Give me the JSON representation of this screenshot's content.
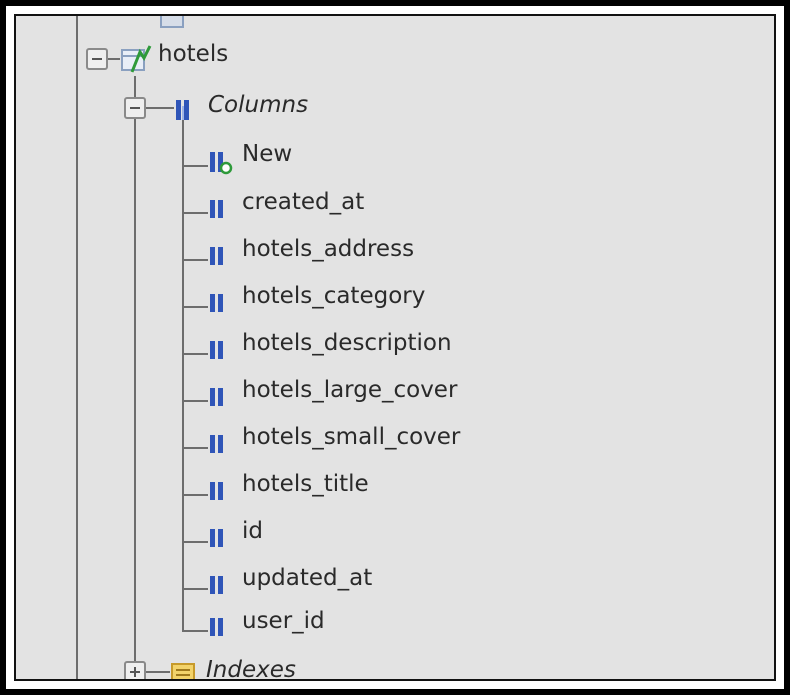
{
  "tree": {
    "table": {
      "label": "hotels",
      "icon": "table-icon",
      "expander": "minus"
    },
    "columns_group": {
      "label": "Columns",
      "icon": "columns-icon",
      "expander": "minus"
    },
    "columns": [
      {
        "label": "New",
        "icon": "new-column-icon"
      },
      {
        "label": "created_at",
        "icon": "column-icon"
      },
      {
        "label": "hotels_address",
        "icon": "column-icon"
      },
      {
        "label": "hotels_category",
        "icon": "column-icon"
      },
      {
        "label": "hotels_description",
        "icon": "column-icon"
      },
      {
        "label": "hotels_large_cover",
        "icon": "column-icon"
      },
      {
        "label": "hotels_small_cover",
        "icon": "column-icon"
      },
      {
        "label": "hotels_title",
        "icon": "column-icon"
      },
      {
        "label": "id",
        "icon": "column-icon"
      },
      {
        "label": "updated_at",
        "icon": "column-icon"
      },
      {
        "label": "user_id",
        "icon": "column-icon"
      }
    ],
    "indexes_group": {
      "label": "Indexes",
      "icon": "indexes-icon",
      "expander": "plus"
    }
  },
  "colors": {
    "background": "#e3e3e3",
    "tree_line": "#6d6d6d",
    "column_icon_blue": "#2f55b8",
    "text": "#2a2a2a"
  }
}
